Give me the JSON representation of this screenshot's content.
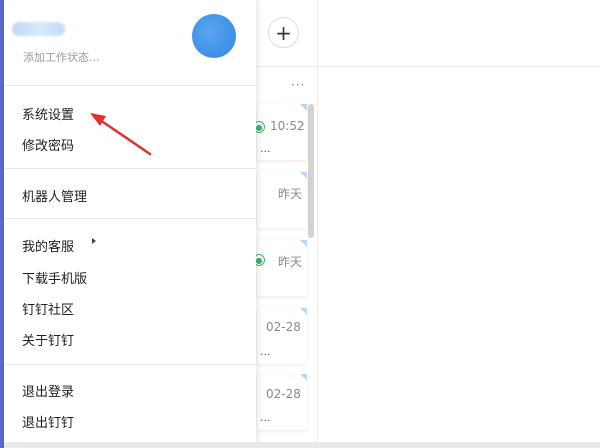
{
  "colors": {
    "accent": "#2f86e0",
    "annotation_arrow": "#e03030",
    "left_strip": "#5b6ad0",
    "online_badge": "#3cb371"
  },
  "profile": {
    "status_placeholder": "添加工作状态..."
  },
  "background": {
    "add_icon": "+",
    "more_icon": "···",
    "chats": [
      {
        "time": "10:52",
        "preview": "...",
        "badge": true
      },
      {
        "time": "昨天",
        "preview": "",
        "badge": false
      },
      {
        "time": "昨天",
        "preview": "",
        "badge": true
      },
      {
        "time": "02-28",
        "preview": "...",
        "badge": false
      },
      {
        "time": "02-28",
        "preview": "...",
        "badge": false
      }
    ]
  },
  "menu": {
    "items": [
      {
        "label": "系统设置"
      },
      {
        "label": "修改密码"
      },
      {
        "label": "机器人管理"
      },
      {
        "label": "我的客服"
      },
      {
        "label": "下载手机版"
      },
      {
        "label": "钉钉社区"
      },
      {
        "label": "关于钉钉"
      },
      {
        "label": "退出登录"
      },
      {
        "label": "退出钉钉"
      }
    ]
  }
}
